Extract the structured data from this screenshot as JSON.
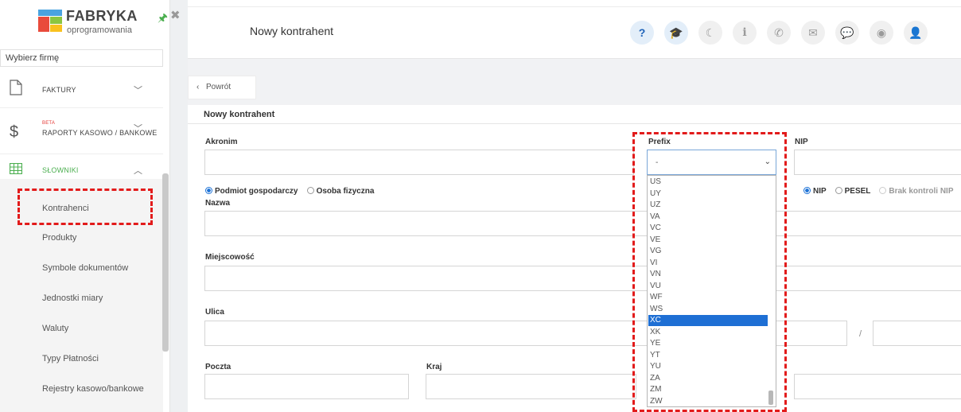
{
  "sidebar": {
    "logo_title": "FABRYKA",
    "logo_subtitle": "oprogramowania",
    "firm_select": "Wybierz firmę",
    "menu": [
      {
        "label": "FAKTURY"
      },
      {
        "badge": "BETA",
        "label": "RAPORTY KASOWO / BANKOWE"
      },
      {
        "label": "SŁOWNIKI"
      }
    ],
    "submenu": [
      "Kontrahenci",
      "Produkty",
      "Symbole dokumentów",
      "Jednostki miary",
      "Waluty",
      "Typy Płatności",
      "Rejestry kasowo/bankowe"
    ]
  },
  "header": {
    "title": "Nowy kontrahent",
    "icons": [
      "question-icon",
      "graduation-cap-icon",
      "moon-icon",
      "info-icon",
      "phone-icon",
      "envelope-icon",
      "chat-icon",
      "globe-icon",
      "user-icon"
    ]
  },
  "content": {
    "back_label": "Powrót",
    "panel_title": "Nowy kontrahent",
    "akronim_label": "Akronim",
    "prefix_label": "Prefix",
    "prefix_value": "-",
    "nip_label": "NIP",
    "entity_types": [
      "Podmiot gospodarczy",
      "Osoba fizyczna"
    ],
    "id_types": [
      "NIP",
      "PESEL",
      "Brak kontroli NIP"
    ],
    "nazwa_label": "Nazwa",
    "miejscowosc_label": "Miejscowość",
    "ulica_label": "Ulica",
    "poczta_label": "Poczta",
    "kraj_label": "Kraj",
    "street_separator": "/"
  },
  "prefix_options": [
    "US",
    "UY",
    "UZ",
    "VA",
    "VC",
    "VE",
    "VG",
    "VI",
    "VN",
    "VU",
    "WF",
    "WS",
    "XC",
    "XK",
    "YE",
    "YT",
    "YU",
    "ZA",
    "ZM",
    "ZW"
  ],
  "prefix_selected": "XC",
  "colors": {
    "accent": "#1e6fd4",
    "highlight": "#e21b1b",
    "menu_active": "#4caf50"
  }
}
